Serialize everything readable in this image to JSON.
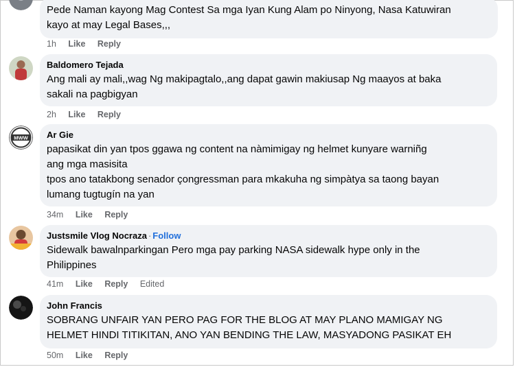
{
  "comments": [
    {
      "author": "",
      "lines": [
        "Pede Naman kayong Mag Contest Sa mga Iyan Kung Alam po Ninyong, Nasa Katuwiran",
        "kayo at may Legal Bases,,,"
      ],
      "time": "1h",
      "like": "Like",
      "reply": "Reply",
      "avatar_icon": "profile-photo-icon"
    },
    {
      "author": "Baldomero Tejada",
      "lines": [
        "Ang mali ay mali,,wag Ng makipagtalo,,ang dapat gawin makiusap Ng maayos at baka",
        "sakali na pagbigyan"
      ],
      "time": "2h",
      "like": "Like",
      "reply": "Reply",
      "avatar_icon": "profile-photo-icon"
    },
    {
      "author": "Ar Gie",
      "lines": [
        "papasikat din yan tpos ggawa ng content na nàmimigay ng helmet kunyare warniñg",
        "ang mga masisita",
        "tpos ano tatakbong senador çongressman para mkakuha ng simpàtya sa taong bayan",
        "lumang tugtugín na yan"
      ],
      "time": "34m",
      "like": "Like",
      "reply": "Reply",
      "avatar_icon": "mww-logo-icon",
      "avatar_text": "MWW"
    },
    {
      "author": "Justsmile Vlog Nocraza",
      "author_sep": "·",
      "follow": "Follow",
      "lines": [
        "Sidewalk bawalnparkingan Pero mga pay parking NASA sidewalk hype only in the",
        "Philippines"
      ],
      "time": "41m",
      "like": "Like",
      "reply": "Reply",
      "edited": "Edited",
      "avatar_icon": "profile-photo-icon"
    },
    {
      "author": "John Francis",
      "lines": [
        "SOBRANG UNFAIR YAN PERO PAG FOR THE BLOG AT MAY PLANO MAMIGAY NG",
        "HELMET HINDI TITIKITAN, ANO YAN BENDING THE LAW, MASYADONG PASIKAT EH"
      ],
      "time": "50m",
      "like": "Like",
      "reply": "Reply",
      "avatar_icon": "profile-photo-icon"
    }
  ],
  "colors": {
    "bubble": "#f0f2f5",
    "meta": "#65676b",
    "follow": "#216fdb",
    "text": "#050505"
  }
}
